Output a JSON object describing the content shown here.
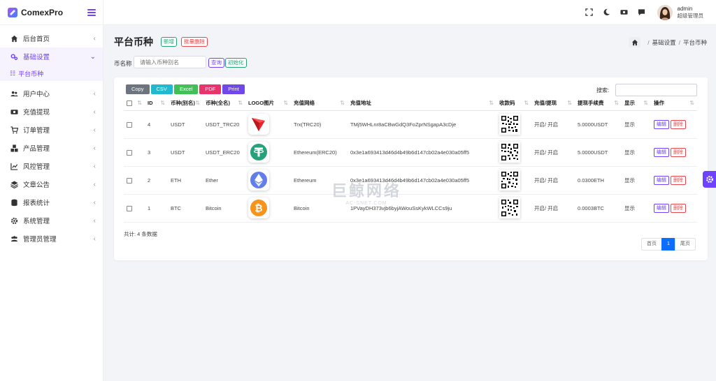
{
  "brand": {
    "name": "ComexPro"
  },
  "sidebar": {
    "items": [
      {
        "label": "后台首页",
        "icon": "home-icon"
      },
      {
        "label": "基础设置",
        "icon": "gears-icon",
        "active": true,
        "sub": [
          {
            "label": "平台币种"
          }
        ]
      },
      {
        "label": "用户中心",
        "icon": "users-icon"
      },
      {
        "label": "充值提现",
        "icon": "money-icon"
      },
      {
        "label": "订单管理",
        "icon": "cart-icon"
      },
      {
        "label": "产品管理",
        "icon": "cubes-icon"
      },
      {
        "label": "风控管理",
        "icon": "chart-icon"
      },
      {
        "label": "文章公告",
        "icon": "layers-icon"
      },
      {
        "label": "报表统计",
        "icon": "database-icon"
      },
      {
        "label": "系统管理",
        "icon": "cog-icon"
      },
      {
        "label": "管理员管理",
        "icon": "users-cog-icon"
      }
    ]
  },
  "header": {
    "user_name": "admin",
    "user_role": "超级管理员"
  },
  "page": {
    "title": "平台币种",
    "add_label": "新增",
    "batch_delete_label": "批量删除",
    "breadcrumb": [
      "基础设置",
      "平台币种"
    ]
  },
  "filter": {
    "label": "币名称",
    "placeholder": "请输入币种别名",
    "query_label": "查询",
    "reset_label": "初始化"
  },
  "table": {
    "export_buttons": [
      {
        "label": "Copy",
        "color": "#6c757d"
      },
      {
        "label": "CSV",
        "color": "#22b8cf"
      },
      {
        "label": "Excel",
        "color": "#40c057"
      },
      {
        "label": "PDF",
        "color": "#e8336d"
      },
      {
        "label": "Print",
        "color": "#7048e8"
      }
    ],
    "search_label": "搜索:",
    "columns": [
      "ID",
      "币种(别名)",
      "币种(全名)",
      "LOGO图片",
      "充值网络",
      "充值地址",
      "收款码",
      "充值/提现",
      "提现手续费",
      "显示",
      "操作"
    ],
    "rows": [
      {
        "id": "4",
        "alias": "USDT",
        "full": "USDT_TRC20",
        "logo": "tron-logo-icon",
        "network": "Trx(TRC20)",
        "address": "TMj5WHLnr8aCBwGdQ3FoZprNSgapA3cDje",
        "status": "开启/ 开启",
        "fee": "5.0000USDT",
        "show": "显示"
      },
      {
        "id": "3",
        "alias": "USDT",
        "full": "USDT_ERC20",
        "logo": "tether-logo-icon",
        "network": "Ethereum(ERC20)",
        "address": "0x3e1a693413d46d4b49b6d147cb02a4e030a05ff5",
        "status": "开启/ 开启",
        "fee": "5.0000USDT",
        "show": "显示"
      },
      {
        "id": "2",
        "alias": "ETH",
        "full": "Ether",
        "logo": "ethereum-logo-icon",
        "network": "Ethereum",
        "address": "0x3e1a693413d46d4b49b6d147cb02a4e030a05ff5",
        "status": "开启/ 开启",
        "fee": "0.0300ETH",
        "show": "显示"
      },
      {
        "id": "1",
        "alias": "BTC",
        "full": "Bitcoin",
        "logo": "bitcoin-logo-icon",
        "network": "Bitcoin",
        "address": "1PVayDH373vjb6byjAWouSsKykWLCCs9ju",
        "status": "开启/ 开启",
        "fee": "0.0003BTC",
        "show": "显示"
      }
    ],
    "edit_label": "编辑",
    "delete_label": "删除",
    "total_text": "共计: 4 条数据"
  },
  "pagination": {
    "first": "首页",
    "current": "1",
    "last": "尾页"
  },
  "watermark": {
    "main": "巨鲸网络",
    "sub": "AC-SNET.COM"
  },
  "colors": {
    "accent": "#6f42ff",
    "success": "#20a371",
    "danger": "#e5484d",
    "primary": "#0d6efd"
  }
}
